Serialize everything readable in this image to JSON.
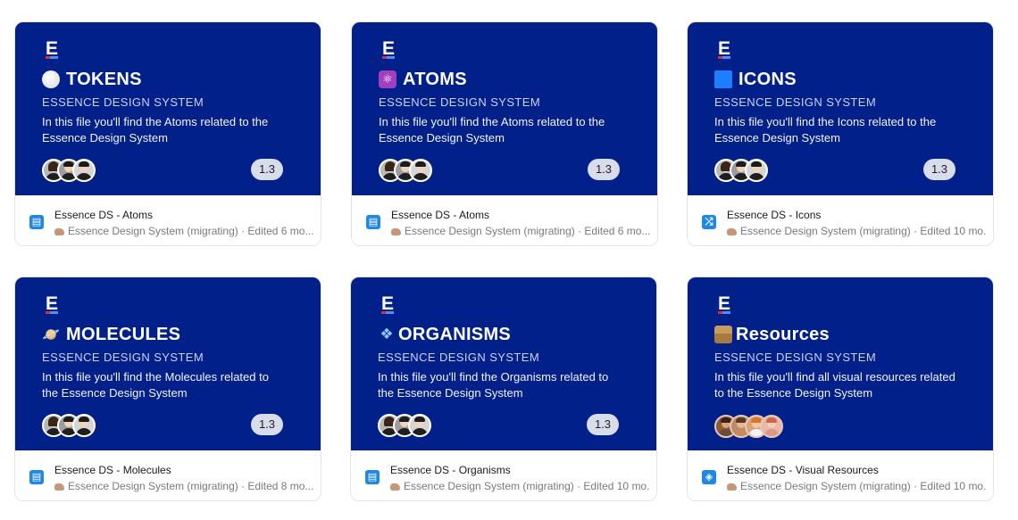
{
  "colors": {
    "thumbnail_bg": "#02208a",
    "accent_red": "#dd2b3a",
    "file_icon_blue": "#1e88e5",
    "version_pill": "#d9dcea"
  },
  "logo_letter": "E",
  "cards": [
    {
      "title": "TOKENS",
      "emoji": "white-circle-icon",
      "subtitle": "ESSENCE DESIGN SYSTEM",
      "description": "In this file you'll find the Atoms related to the Essence Design System",
      "version": "1.3",
      "file_name": "Essence DS - Atoms",
      "file_sub": "Essence Design System (migrating) · Edited 6 mo...",
      "file_icon": "book-icon",
      "file_icon_glyph": "📖"
    },
    {
      "title": "ATOMS",
      "emoji": "atom-icon",
      "subtitle": "ESSENCE DESIGN SYSTEM",
      "description": "In this file you'll find the Atoms related to the Essence Design System",
      "version": "1.3",
      "file_name": "Essence DS - Atoms",
      "file_sub": "Essence Design System (migrating) · Edited 6 mo...",
      "file_icon": "book-icon",
      "file_icon_glyph": "📖"
    },
    {
      "title": "ICONS",
      "emoji": "blue-square-icon",
      "subtitle": "ESSENCE DESIGN SYSTEM",
      "description": "In this file you'll find the Icons related to the Essence Design System",
      "version": "1.3",
      "file_name": "Essence DS - Icons",
      "file_sub": "Essence Design System (migrating) · Edited 10 mo...",
      "file_icon": "shuffle-icon",
      "file_icon_glyph": "⤮"
    },
    {
      "title": "MOLECULES",
      "emoji": "ringed-planet-icon",
      "subtitle": "ESSENCE DESIGN SYSTEM",
      "description": "In this file you'll find the Molecules related to the Essence Design System",
      "version": "1.3",
      "file_name": "Essence DS - Molecules",
      "file_sub": "Essence Design System (migrating) · Edited 8 mo...",
      "file_icon": "book-icon",
      "file_icon_glyph": "📖"
    },
    {
      "title": "ORGANISMS",
      "emoji": "diamond-cluster-icon",
      "subtitle": "ESSENCE DESIGN SYSTEM",
      "description": "In this file you'll find the Organisms related to the Essence Design System",
      "version": "1.3",
      "file_name": "Essence DS - Organisms",
      "file_sub": "Essence Design System (migrating) · Edited 10 mo...",
      "file_icon": "book-icon",
      "file_icon_glyph": "📖"
    },
    {
      "title": "Resources",
      "emoji": "package-box-icon",
      "subtitle": "ESSENCE DESIGN SYSTEM",
      "description": "In this file you'll find all visual resources related to the Essence Design System",
      "version": "",
      "file_name": "Essence DS - Visual Resources",
      "file_sub": "Essence Design System (migrating) · Edited 10 mo...",
      "file_icon": "tag-icon",
      "file_icon_glyph": "⬗"
    }
  ]
}
